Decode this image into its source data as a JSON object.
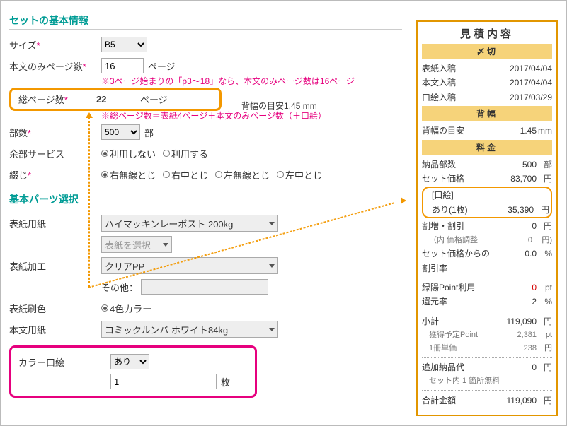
{
  "left": {
    "sect1_title": "セットの基本情報",
    "size_label": "サイズ",
    "size_value": "B5",
    "bodypages_label": "本文のみページ数",
    "bodypages_value": "16",
    "bodypages_unit": "ページ",
    "bodypages_note": "※3ページ始まりの「p3〜18」なら、本文のみページ数は16ページ",
    "totalpages_label": "総ページ数",
    "totalpages_value": "22",
    "totalpages_unit": "ページ",
    "spine_hint_label": "背幅の目安",
    "spine_hint_value": "1.45 mm",
    "totalpages_note": "※総ページ数＝表紙4ページ＋本文のみページ数（＋口絵）",
    "copies_label": "部数",
    "copies_value": "500",
    "copies_unit": "部",
    "extra_label": "余部サービス",
    "extra_opt_no": "利用しない",
    "extra_opt_yes": "利用する",
    "bind_label": "綴じ",
    "bind_opts": [
      "右無線とじ",
      "右中とじ",
      "左無線とじ",
      "左中とじ"
    ],
    "sect2_title": "基本パーツ選択",
    "coverpaper_label": "表紙用紙",
    "coverpaper_value": "ハイマッキンレーポスト 200kg",
    "coverpaper_sub": "表紙を選択",
    "coverproc_label": "表紙加工",
    "coverproc_value": "クリアPP",
    "coverproc_other_label": "その他：",
    "covercolor_label": "表紙刷色",
    "covercolor_opt": "4色カラー",
    "bodypaper_label": "本文用紙",
    "bodypaper_value": "コミックルンバ ホワイト84kg",
    "kuchie_label": "カラー口絵",
    "kuchie_value": "あり",
    "kuchie_sheets": "1",
    "kuchie_unit": "枚"
  },
  "right": {
    "title": "見積内容",
    "sub_due": "〆切",
    "due_cover_label": "表紙入稿",
    "due_cover_val": "2017/04/04",
    "due_body_label": "本文入稿",
    "due_body_val": "2017/04/04",
    "due_kuchie_label": "口絵入稿",
    "due_kuchie_val": "2017/03/29",
    "sub_spine": "背幅",
    "spine_label": "背幅の目安",
    "spine_val": "1.45",
    "spine_unit": "mm",
    "sub_price": "料金",
    "deliver_label": "納品部数",
    "deliver_val": "500",
    "deliver_unit": "部",
    "setprice_label": "セット価格",
    "setprice_val": "83,700",
    "setprice_unit": "円",
    "kuchie_hdr": "[口絵]",
    "kuchie_line": "あり(1枚)",
    "kuchie_val": "35,390",
    "kuchie_unit": "円",
    "adj_label": "割増・割引",
    "adj_val": "0",
    "adj_unit": "円",
    "adj_sub": "（内 価格調整",
    "adj_sub_val": "0",
    "adj_sub_unit": "円)",
    "disc_label": "セット価格からの割引率",
    "disc_val": "0.0",
    "disc_unit": "%",
    "point_use_label": "緑陽Point利用",
    "point_use_val": "0",
    "point_use_unit": "pt",
    "redeem_label": "還元率",
    "redeem_val": "2",
    "redeem_unit": "%",
    "subtotal_label": "小計",
    "subtotal_val": "119,090",
    "subtotal_unit": "円",
    "expect_point_label": "獲得予定Point",
    "expect_point_val": "2,381",
    "expect_point_unit": "pt",
    "unit_price_label": "1冊単価",
    "unit_price_val": "238",
    "unit_price_unit": "円",
    "extra_ship_label": "追加納品代",
    "extra_ship_val": "0",
    "extra_ship_unit": "円",
    "extra_ship_sub": "セット内 1 箇所無料",
    "total_label": "合計金額",
    "total_val": "119,090",
    "total_unit": "円"
  }
}
